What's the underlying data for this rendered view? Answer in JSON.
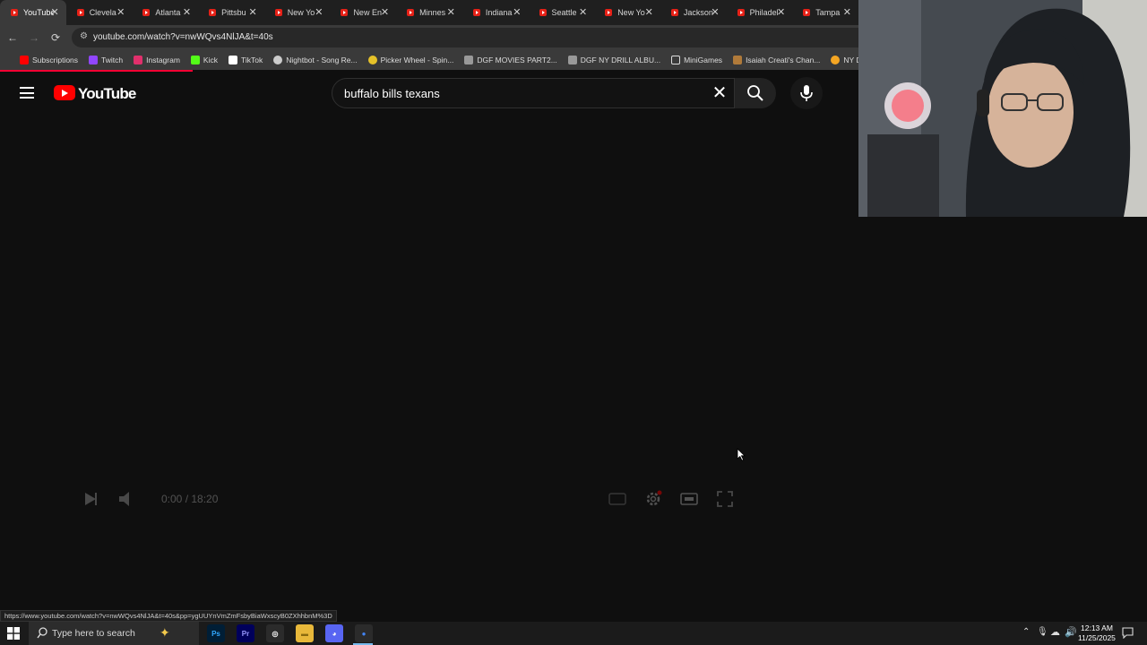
{
  "browser": {
    "tabs": [
      {
        "label": "YouTube",
        "active": true
      },
      {
        "label": "Clevela",
        "active": false
      },
      {
        "label": "Atlanta",
        "active": false
      },
      {
        "label": "Pittsbu",
        "active": false
      },
      {
        "label": "New Yo",
        "active": false
      },
      {
        "label": "New En",
        "active": false
      },
      {
        "label": "Minnes",
        "active": false
      },
      {
        "label": "Indiana",
        "active": false
      },
      {
        "label": "Seattle",
        "active": false
      },
      {
        "label": "New Yo",
        "active": false
      },
      {
        "label": "Jackson",
        "active": false
      },
      {
        "label": "Philadel",
        "active": false
      },
      {
        "label": "Tampa",
        "active": false
      }
    ],
    "tab_close_glyph": "✕",
    "url": "youtube.com/watch?v=nwWQvs4NlJA&t=40s",
    "bookmarks": [
      {
        "label": "Subscriptions",
        "icon": "youtube-icon",
        "color": "#ff0000"
      },
      {
        "label": "Twitch",
        "icon": "twitch-icon",
        "color": "#9146ff"
      },
      {
        "label": "Instagram",
        "icon": "instagram-icon",
        "color": "#e1306c"
      },
      {
        "label": "Kick",
        "icon": "kick-icon",
        "color": "#53fc18"
      },
      {
        "label": "TikTok",
        "icon": "tiktok-icon",
        "color": "#ffffff"
      },
      {
        "label": "Nightbot - Song Re...",
        "icon": "nightbot-icon",
        "color": "#cccccc"
      },
      {
        "label": "Picker Wheel - Spin...",
        "icon": "wheel-icon",
        "color": "#e6c229"
      },
      {
        "label": "DGF MOVIES PART2...",
        "icon": "page-icon",
        "color": "#999999"
      },
      {
        "label": "DGF NY DRILL ALBU...",
        "icon": "page-icon",
        "color": "#999999"
      },
      {
        "label": "MiniGames",
        "icon": "folder-icon",
        "color": "#dcdcdc"
      },
      {
        "label": "Isaiah Creati's Chan...",
        "icon": "channel-icon",
        "color": "#b07a3a"
      },
      {
        "label": "NY Drill Deads",
        "icon": "bulb-icon",
        "color": "#f5a623"
      }
    ]
  },
  "youtube": {
    "logo_text": "YouTube",
    "search_value": "buffalo bills texans",
    "search_placeholder": "Search"
  },
  "player": {
    "time_display": "0:00 / 18:20"
  },
  "status_url": "https://www.youtube.com/watch?v=nwWQvs4NlJA&t=40s&pp=ygUUYnVmZmFsbyBiaWxscyB0ZXhhbnM%3D",
  "taskbar": {
    "search_placeholder": "Type here to search",
    "apps": [
      {
        "name": "photoshop",
        "label": "Ps",
        "bg": "#001e36",
        "fg": "#31a8ff"
      },
      {
        "name": "premiere",
        "label": "Pr",
        "bg": "#00005b",
        "fg": "#9999ff"
      },
      {
        "name": "obs",
        "label": "◎",
        "bg": "#2b2b2b",
        "fg": "#ffffff"
      },
      {
        "name": "file-explorer",
        "label": "▬",
        "bg": "#e8b83a",
        "fg": "#8a6a10"
      },
      {
        "name": "discord",
        "label": "◕",
        "bg": "#5865f2",
        "fg": "#ffffff"
      },
      {
        "name": "chrome",
        "label": "●",
        "bg": "#2b2b2b",
        "fg": "#4285f4"
      }
    ],
    "clock_time": "12:13 AM",
    "clock_date": "11/25/2025"
  },
  "colors": {
    "youtube_red": "#ff0000",
    "page_bg": "#0f0f0f",
    "chrome_dark": "#3a3a3a"
  }
}
